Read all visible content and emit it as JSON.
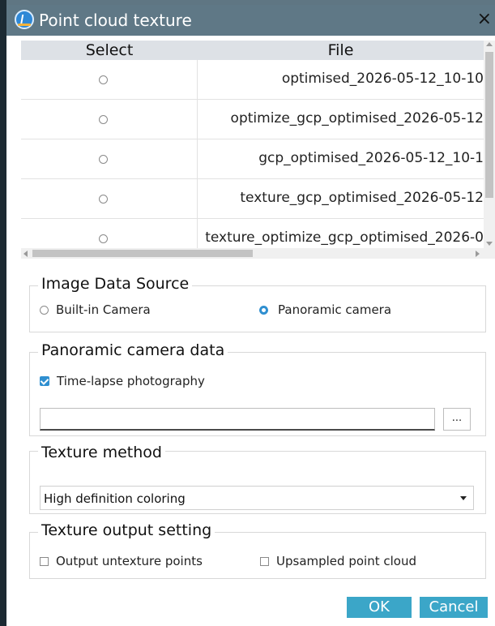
{
  "window": {
    "title": "Point cloud texture",
    "close_glyph": "×"
  },
  "table": {
    "headers": {
      "select": "Select",
      "file": "File"
    },
    "rows": [
      {
        "file": "optimised_2026-05-12_10-10"
      },
      {
        "file": "optimize_gcp_optimised_2026-05-12"
      },
      {
        "file": "gcp_optimised_2026-05-12_10-1"
      },
      {
        "file": "texture_gcp_optimised_2026-05-12"
      },
      {
        "file": "texture_optimize_gcp_optimised_2026-0"
      }
    ]
  },
  "image_data_source": {
    "legend": "Image Data Source",
    "options": [
      {
        "label": "Built-in Camera",
        "selected": false
      },
      {
        "label": "Panoramic camera",
        "selected": true
      }
    ]
  },
  "panoramic_camera_data": {
    "legend": "Panoramic camera data",
    "timelapse_label": "Time-lapse photography",
    "timelapse_checked": true,
    "path_value": "",
    "browse_label": "..."
  },
  "texture_method": {
    "legend": "Texture method",
    "selected": "High definition coloring"
  },
  "texture_output": {
    "legend": "Texture output setting",
    "options": [
      {
        "label": "Output untexture points",
        "checked": false
      },
      {
        "label": "Upsampled point cloud",
        "checked": false
      }
    ]
  },
  "buttons": {
    "ok": "OK",
    "cancel": "Cancel"
  },
  "colors": {
    "titlebar": "#5f7886",
    "accent": "#2f8fd0",
    "button": "#3ba6c8"
  }
}
